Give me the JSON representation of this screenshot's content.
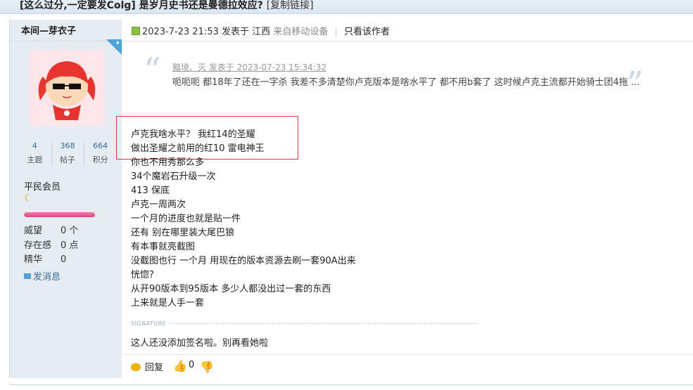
{
  "thread": {
    "title": "[这么过分,一定要发Colg] 是岁月史书还是曼德拉效应?",
    "copy_link": "[复制链接]"
  },
  "author": {
    "name": "本间—芽衣子",
    "stats": [
      {
        "value": "4",
        "label": "主题"
      },
      {
        "value": "368",
        "label": "帖子"
      },
      {
        "value": "664",
        "label": "积分"
      }
    ],
    "rank": "平民会员",
    "rank_icon": "moon-icon",
    "progress": 0.85,
    "props": [
      {
        "label": "威望",
        "value": "0 个"
      },
      {
        "label": "存在感",
        "value": "0 点"
      },
      {
        "label": "精华",
        "value": "0"
      }
    ],
    "send_message": "发消息"
  },
  "post": {
    "date": "2023-7-23 21:53",
    "posted_in": "发表于",
    "location": "江西",
    "device": "来自移动设备",
    "only_author": "只看该作者",
    "quote": {
      "author_line": "黯境、灭 发表于 2023-07-23 15:34:32",
      "text": "呃呃呃 都18年了还在一字杀 我差不多清楚你卢克版本是啥水平了 都不用b套了 这时候卢克主流都开始骑士团4拖 ..."
    },
    "lines": [
      "卢克我啥水平？ 我红14的圣耀",
      "做出圣耀之前用的红10 雷电神王",
      "你也不用秀那么多",
      "34个魔岩石升级一次",
      "413 保底",
      "卢克一周两次",
      "一个月的进度也就是贴一件",
      "还有 别在哪里装大尾巴狼",
      "有本事就亮截图",
      "没截图也行  一个月 用现在的版本资源去刷一套90A出来",
      "恍惚?",
      "从开90版本到95版本 多少人都没出过一套的东西",
      "上来就是人手一套"
    ],
    "signature_label": "SIGNATURE",
    "signature": "这人还没添加签名啦。别再看她啦",
    "reply_label": "回复",
    "like_count": "0"
  }
}
